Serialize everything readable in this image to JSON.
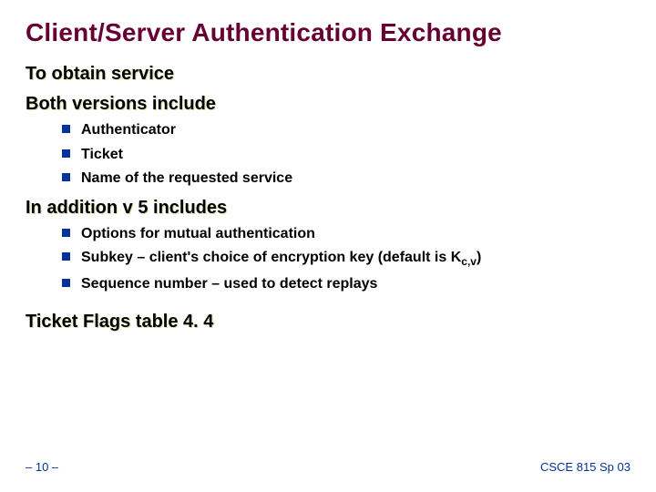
{
  "title": "Client/Server Authentication Exchange",
  "headings": {
    "h1": "To obtain service",
    "h2": "Both versions include",
    "h3": "In addition v 5 includes",
    "h4": "Ticket Flags table 4. 4"
  },
  "list1": {
    "i0": "Authenticator",
    "i1": "Ticket",
    "i2": "Name of the requested service"
  },
  "list2": {
    "i0": "Options for mutual authentication",
    "i1_pre": "Subkey – client's choice of encryption key (default is K",
    "i1_sub": "c,v",
    "i1_post": ")",
    "i2": "Sequence number – used to detect replays"
  },
  "footer": {
    "left": "– 10 –",
    "right": "CSCE 815 Sp 03"
  }
}
